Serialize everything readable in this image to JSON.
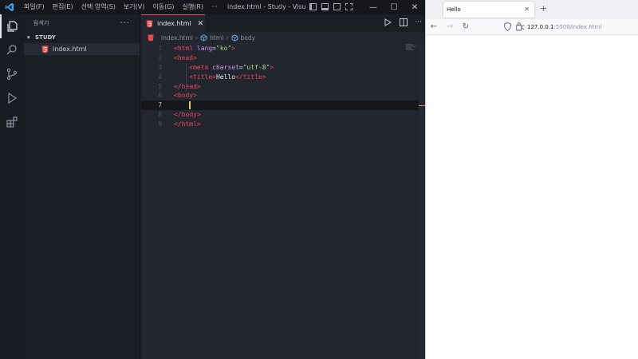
{
  "vscode": {
    "menu": [
      "파일(F)",
      "편집(E)",
      "선택 영역(S)",
      "보기(V)",
      "이동(G)",
      "실행(R)",
      "···"
    ],
    "window_title": "index.html - Study - Visual S...",
    "window_controls": {
      "minimize": "—",
      "maximize": "☐",
      "close": "✕"
    },
    "activity_icons": [
      "explorer-icon",
      "search-icon",
      "source-control-icon",
      "run-debug-icon",
      "extensions-icon"
    ],
    "explorer": {
      "title": "탐색기",
      "more": "···",
      "folder": "STUDY",
      "files": [
        "index.html"
      ]
    },
    "editor": {
      "tab_label": "index.html",
      "tab_close": "✕",
      "breadcrumb": [
        "index.html",
        "html",
        "body"
      ],
      "lines": [
        {
          "n": "1",
          "tokens": [
            [
              "tag",
              "<html "
            ],
            [
              "attr",
              "lang"
            ],
            [
              "txt",
              "="
            ],
            [
              "str",
              "\"ko\""
            ],
            [
              "tag",
              ">"
            ]
          ]
        },
        {
          "n": "2",
          "tokens": [
            [
              "tag",
              "<head>"
            ]
          ]
        },
        {
          "n": "3",
          "tokens": [
            [
              "txt",
              "    "
            ],
            [
              "tag",
              "<meta "
            ],
            [
              "attr",
              "charset"
            ],
            [
              "txt",
              "="
            ],
            [
              "str",
              "\"utf-8\""
            ],
            [
              "tag",
              ">"
            ]
          ]
        },
        {
          "n": "4",
          "tokens": [
            [
              "txt",
              "    "
            ],
            [
              "tag",
              "<title>"
            ],
            [
              "txt",
              "Hello"
            ],
            [
              "tag",
              "</title>"
            ]
          ]
        },
        {
          "n": "5",
          "tokens": [
            [
              "tag",
              "</head>"
            ]
          ]
        },
        {
          "n": "6",
          "tokens": [
            [
              "tag",
              "<body>"
            ]
          ]
        },
        {
          "n": "7",
          "tokens": [
            [
              "txt",
              "    "
            ],
            [
              "cursor",
              ""
            ]
          ]
        },
        {
          "n": "8",
          "tokens": [
            [
              "tag",
              "</body>"
            ]
          ]
        },
        {
          "n": "9",
          "tokens": [
            [
              "tag",
              "</html>"
            ]
          ]
        }
      ],
      "current_line": "7"
    }
  },
  "browser": {
    "tab_title": "Hello",
    "tab_close": "✕",
    "new_tab": "+",
    "nav": {
      "back": "←",
      "forward": "→",
      "reload": "↻"
    },
    "url_host": "127.0.0.1",
    "url_rest": ":5500/index.html"
  },
  "colors": {
    "tag": "#e8475f",
    "attr": "#c895f2",
    "string": "#a9dc76",
    "cursor": "#f2c744",
    "vscode_blue": "#3b9ee8",
    "html_icon": "#e44d4d"
  }
}
